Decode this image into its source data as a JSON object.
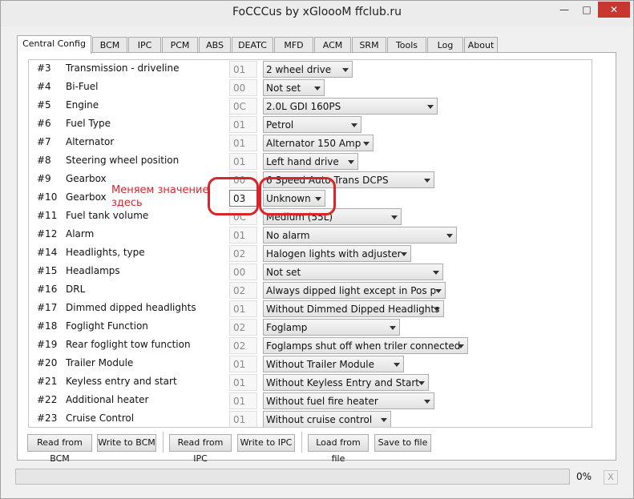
{
  "window": {
    "title": "FoCCCus by xGloooM ffclub.ru",
    "minimize": "—",
    "maximize": "□",
    "close": "✕"
  },
  "tabs": [
    "Central Config",
    "BCM",
    "IPC",
    "PCM",
    "ABS",
    "DEATC",
    "MFD",
    "ACM",
    "SRM",
    "Tools",
    "Log",
    "About"
  ],
  "rows": [
    {
      "num": "#3",
      "name": "Transmission - driveline",
      "code": "01",
      "value": "2 wheel drive"
    },
    {
      "num": "#4",
      "name": "Bi-Fuel",
      "code": "00",
      "value": "Not set"
    },
    {
      "num": "#5",
      "name": "Engine",
      "code": "0C",
      "value": "2.0L GDI 160PS"
    },
    {
      "num": "#6",
      "name": "Fuel Type",
      "code": "01",
      "value": "Petrol"
    },
    {
      "num": "#7",
      "name": "Alternator",
      "code": "01",
      "value": "Alternator 150 Amp"
    },
    {
      "num": "#8",
      "name": "Steering wheel position",
      "code": "01",
      "value": "Left hand drive"
    },
    {
      "num": "#9",
      "name": "Gearbox",
      "code": "00",
      "value": "6 Speed Auto Trans DCPS"
    },
    {
      "num": "#10",
      "name": "Gearbox",
      "code": "03",
      "value": "Unknown"
    },
    {
      "num": "#11",
      "name": "Fuel tank volume",
      "code": "0C",
      "value": "Medium (55L)"
    },
    {
      "num": "#12",
      "name": "Alarm",
      "code": "01",
      "value": "No alarm"
    },
    {
      "num": "#14",
      "name": "Headlights, type",
      "code": "02",
      "value": "Halogen lights with adjuster"
    },
    {
      "num": "#15",
      "name": "Headlamps",
      "code": "00",
      "value": "Not set"
    },
    {
      "num": "#16",
      "name": "DRL",
      "code": "02",
      "value": "Always dipped light except in Pos p"
    },
    {
      "num": "#17",
      "name": "Dimmed dipped headlights",
      "code": "01",
      "value": "Without Dimmed Dipped Headlights"
    },
    {
      "num": "#18",
      "name": "Foglight Function",
      "code": "02",
      "value": "Foglamp"
    },
    {
      "num": "#19",
      "name": "Rear foglight tow function",
      "code": "02",
      "value": "Foglamps shut off when triler connected"
    },
    {
      "num": "#20",
      "name": "Trailer Module",
      "code": "01",
      "value": "Without Trailer Module"
    },
    {
      "num": "#21",
      "name": "Keyless entry and start",
      "code": "01",
      "value": "Without Keyless Entry and Start"
    },
    {
      "num": "#22",
      "name": "Additional heater",
      "code": "01",
      "value": "Without fuel fire heater"
    },
    {
      "num": "#23",
      "name": "Cruise Control",
      "code": "01",
      "value": "Without cruise control"
    }
  ],
  "buttons": {
    "read_bcm": "Read from BCM",
    "write_bcm": "Write to BCM",
    "read_ipc": "Read from IPC",
    "write_ipc": "Write to IPC",
    "load_file": "Load from file",
    "save_file": "Save to file"
  },
  "progress": {
    "value": 0,
    "label": "0%"
  },
  "cancel": "X",
  "annotation": {
    "text": "Меняем значение здесь",
    "color": "#d6252b"
  },
  "colors": {
    "progress_fill": "#06b025",
    "close_button": "#c7372f"
  }
}
